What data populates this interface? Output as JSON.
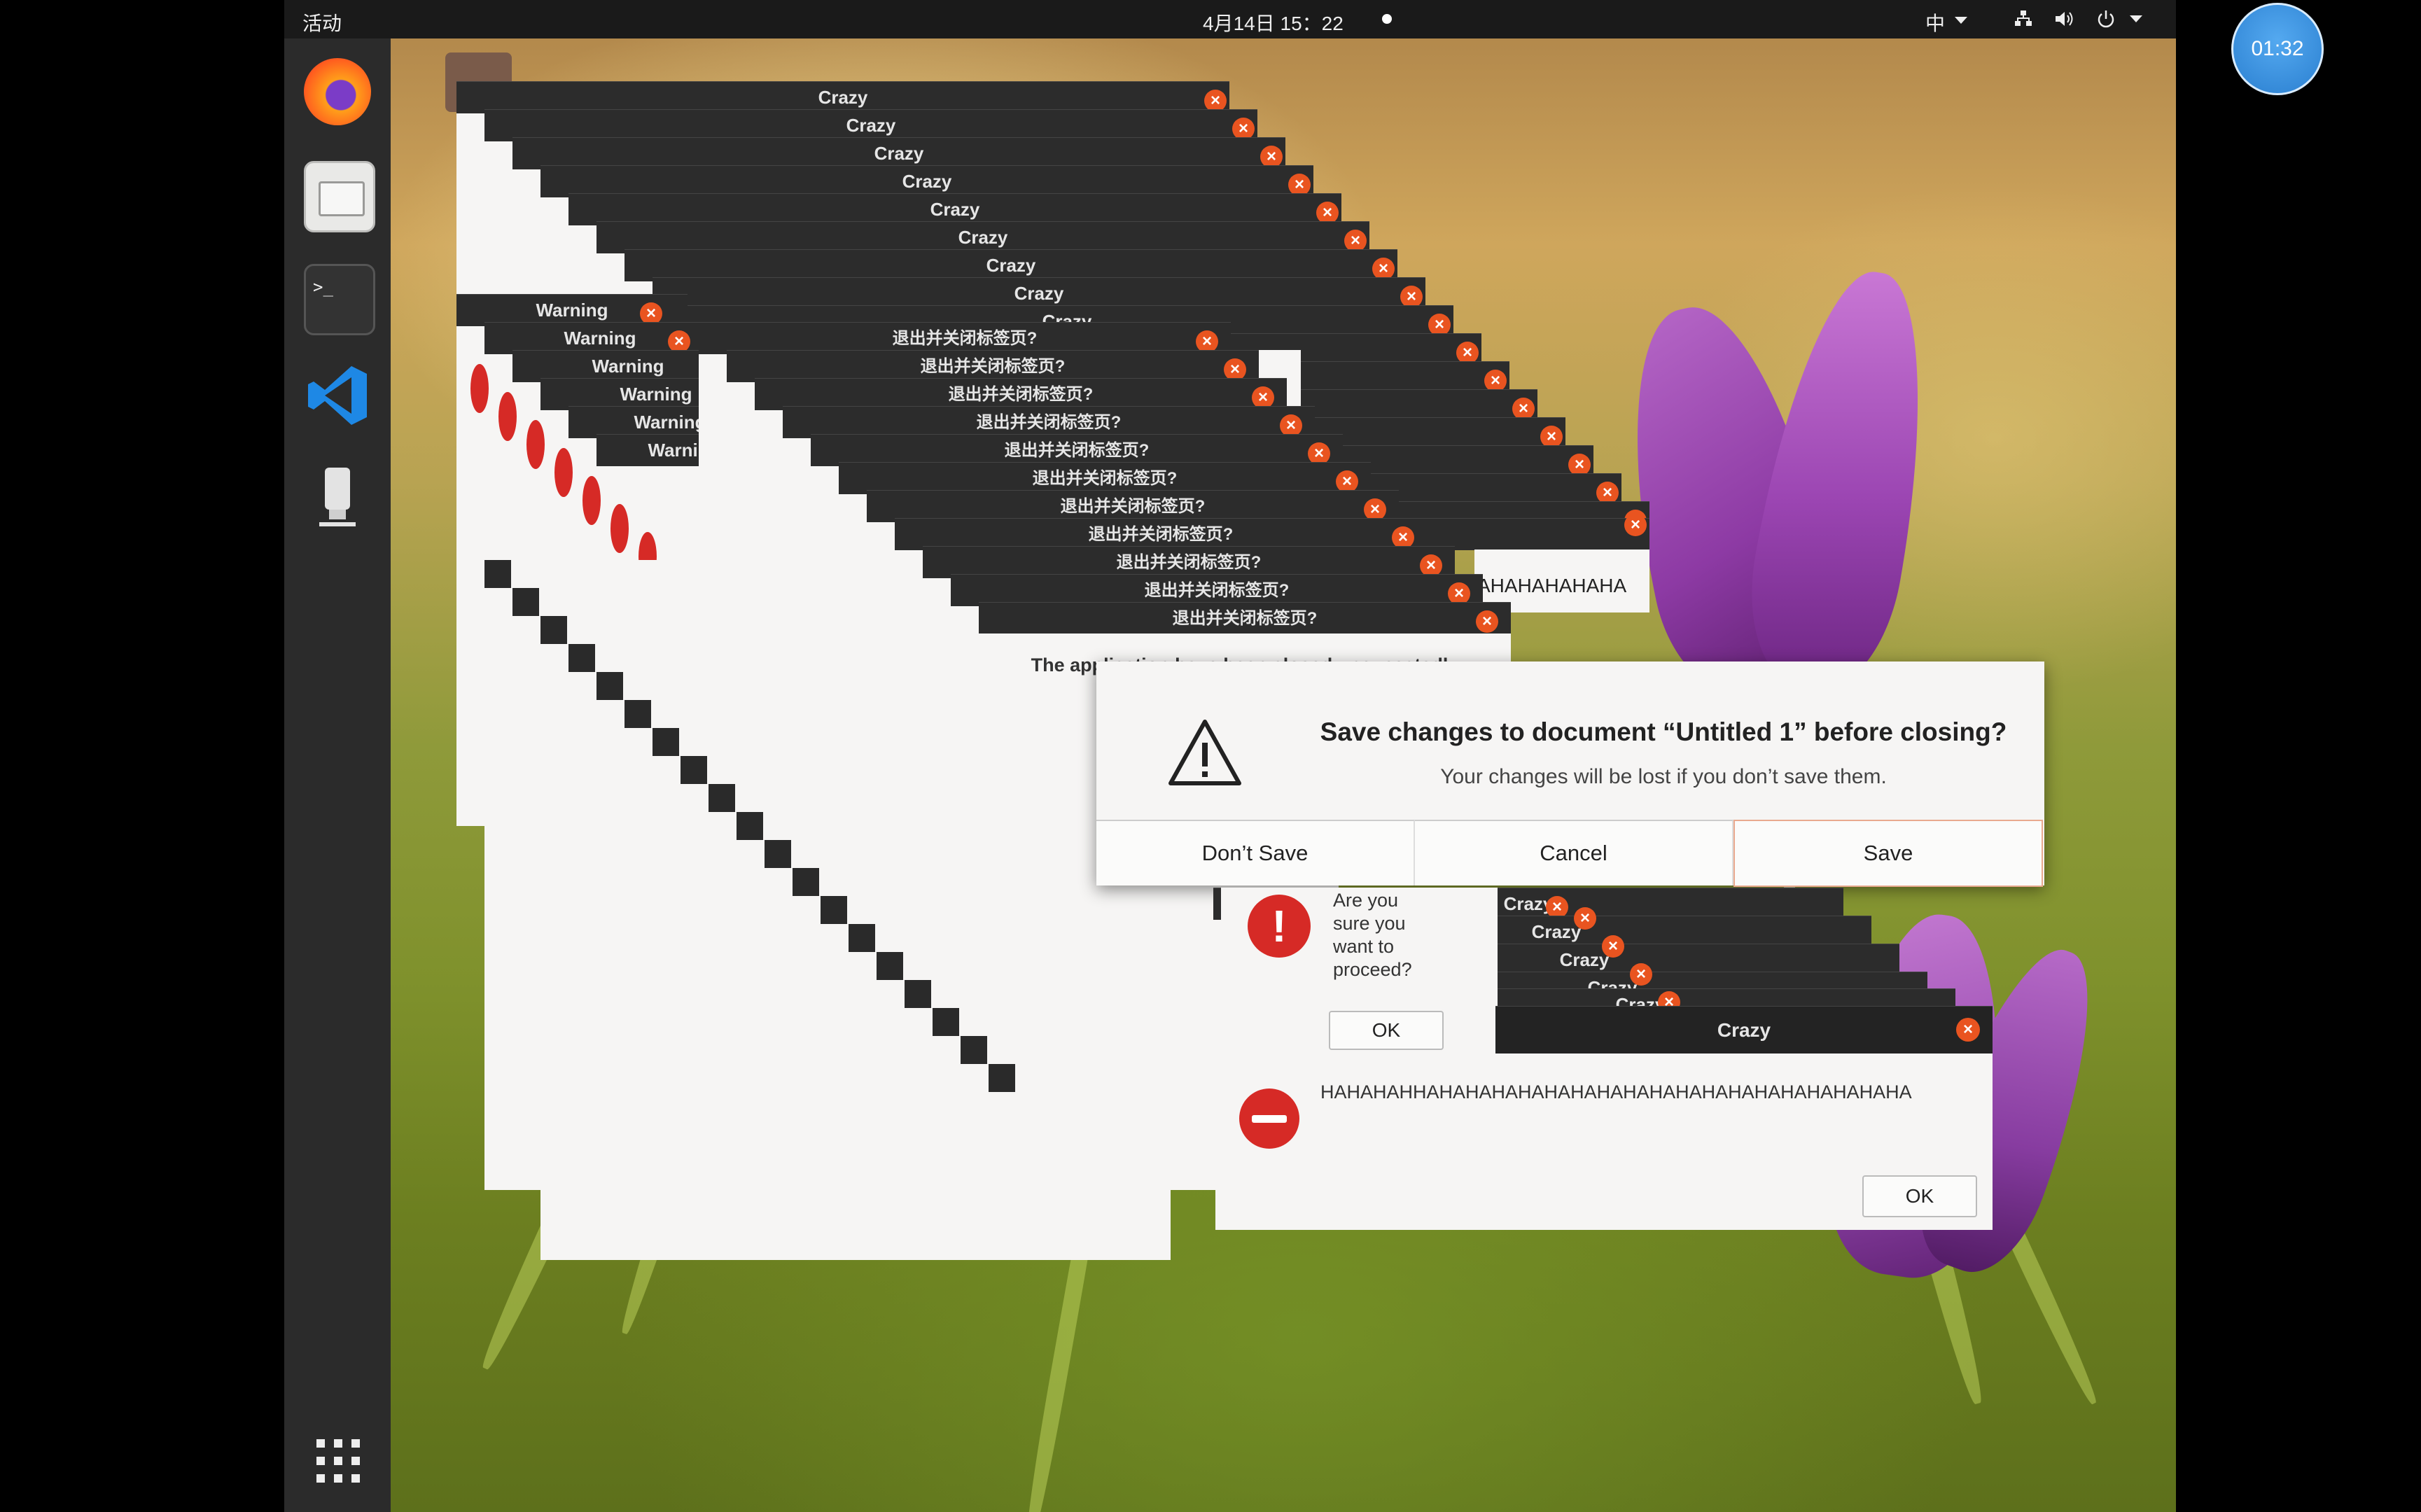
{
  "topbar": {
    "activities": "活动",
    "datetime": "4月14日 15：22",
    "input_method": "中"
  },
  "recording_timer": "01:32",
  "dock": {
    "apps": [
      "firefox-icon",
      "files-icon",
      "terminal-icon",
      "vscode-icon",
      "usb-drive-icon"
    ],
    "show_apps_icon": "app-grid-icon"
  },
  "stacks": {
    "crazy_title": "Crazy",
    "warning_title": "Warning",
    "quit_title": "退出并关闭标签页?",
    "hidden_text": "AHAHAHAHAHA",
    "partial_text": "The application have been closed unexpectedly"
  },
  "save_dialog": {
    "title": "Save changes to document “Untitled 1” before closing?",
    "subtitle": "Your changes will be lost if you don’t save them.",
    "dont_save": "Don’t Save",
    "cancel": "Cancel",
    "save": "Save"
  },
  "confirm_dialog": {
    "message": "Are you sure you want to proceed?",
    "ok": "OK"
  },
  "final_dialog": {
    "title": "Crazy",
    "message": "HAHAHAHHAHAHAHAHAHAHAHAHAHAHAHAHAHAHAHAHAHAHA",
    "ok": "OK"
  },
  "colors": {
    "accent": "#e95420",
    "titlebar": "#2c2c2c",
    "dialog_bg": "#f6f5f4",
    "error_red": "#d62a26"
  }
}
